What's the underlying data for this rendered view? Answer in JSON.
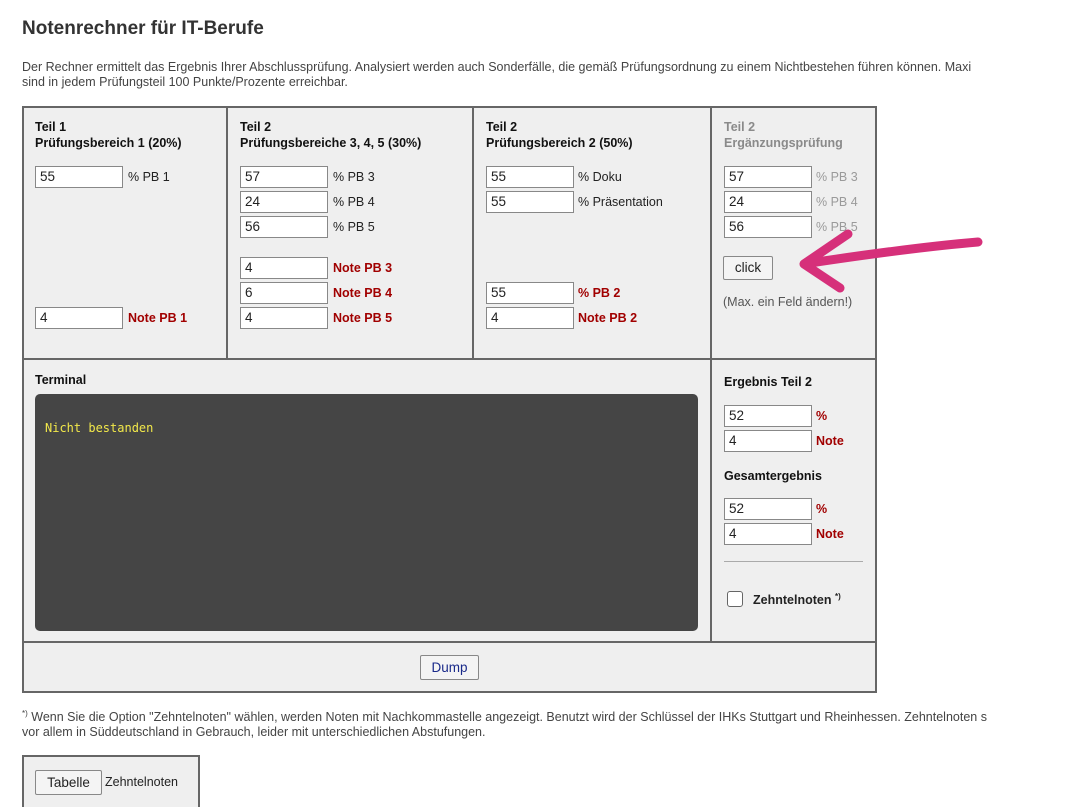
{
  "page": {
    "title": "Notenrechner für IT-Berufe",
    "intro_line1": "Der Rechner ermittelt das Ergebnis Ihrer Abschlussprüfung. Analysiert werden auch Sonderfälle, die gemäß Prüfungsordnung zu einem Nichtbestehen führen können. Maxi",
    "intro_line2": "sind in jedem Prüfungsteil 100 Punkte/Prozente erreichbar."
  },
  "teil1": {
    "head1": "Teil 1",
    "head2": "Prüfungsbereich 1 (20%)",
    "pb1_value": "55",
    "pb1_label": "% PB 1",
    "note_pb1_value": "4",
    "note_pb1_label": "Note PB 1"
  },
  "teil2a": {
    "head1": "Teil 2",
    "head2": "Prüfungsbereiche 3, 4, 5 (30%)",
    "pb3_value": "57",
    "pb3_label": "% PB 3",
    "pb4_value": "24",
    "pb4_label": "% PB 4",
    "pb5_value": "56",
    "pb5_label": "% PB 5",
    "note_pb3_value": "4",
    "note_pb3_label": "Note PB 3",
    "note_pb4_value": "6",
    "note_pb4_label": "Note PB 4",
    "note_pb5_value": "4",
    "note_pb5_label": "Note PB 5"
  },
  "teil2b": {
    "head1": "Teil 2",
    "head2": "Prüfungsbereich 2 (50%)",
    "doku_value": "55",
    "doku_label": "% Doku",
    "praes_value": "55",
    "praes_label": "% Präsentation",
    "pb2_value": "55",
    "pb2_label": "% PB 2",
    "note_pb2_value": "4",
    "note_pb2_label": "Note PB 2"
  },
  "ergaenzung": {
    "head1": "Teil 2",
    "head2": "Ergänzungsprüfung",
    "pb3_value": "57",
    "pb3_label": "% PB 3",
    "pb4_value": "24",
    "pb4_label": "% PB 4",
    "pb5_value": "56",
    "pb5_label": "% PB 5",
    "click_label": "click",
    "hint": "(Max. ein Feld ändern!)"
  },
  "terminal": {
    "label": "Terminal",
    "output": "Nicht bestanden"
  },
  "ergebnis": {
    "teil2_head": "Ergebnis Teil 2",
    "teil2_percent": "52",
    "teil2_note": "4",
    "gesamt_head": "Gesamtergebnis",
    "gesamt_percent": "52",
    "gesamt_note": "4",
    "percent_label": "%",
    "note_label": "Note",
    "zehntel_label": "Zehntelnoten",
    "zehntel_mark": "*)"
  },
  "dump_label": "Dump",
  "footnote": {
    "mark": "*)",
    "line1": " Wenn Sie die Option \"Zehntelnoten\" wählen, werden Noten mit Nachkommastelle angezeigt. Benutzt wird der Schlüssel der IHKs Stuttgart und Rheinhessen. Zehntelnoten s",
    "line2": "vor allem in Süddeutschland in Gebrauch, leider mit unterschiedlichen Abstufungen."
  },
  "tabelle": {
    "button_label": "Tabelle",
    "text": "Zehntelnoten"
  },
  "colors": {
    "annotation_arrow": "#d6307a",
    "red_label": "#a10000",
    "terminal_bg": "#454545",
    "terminal_text": "#f2e84a"
  }
}
